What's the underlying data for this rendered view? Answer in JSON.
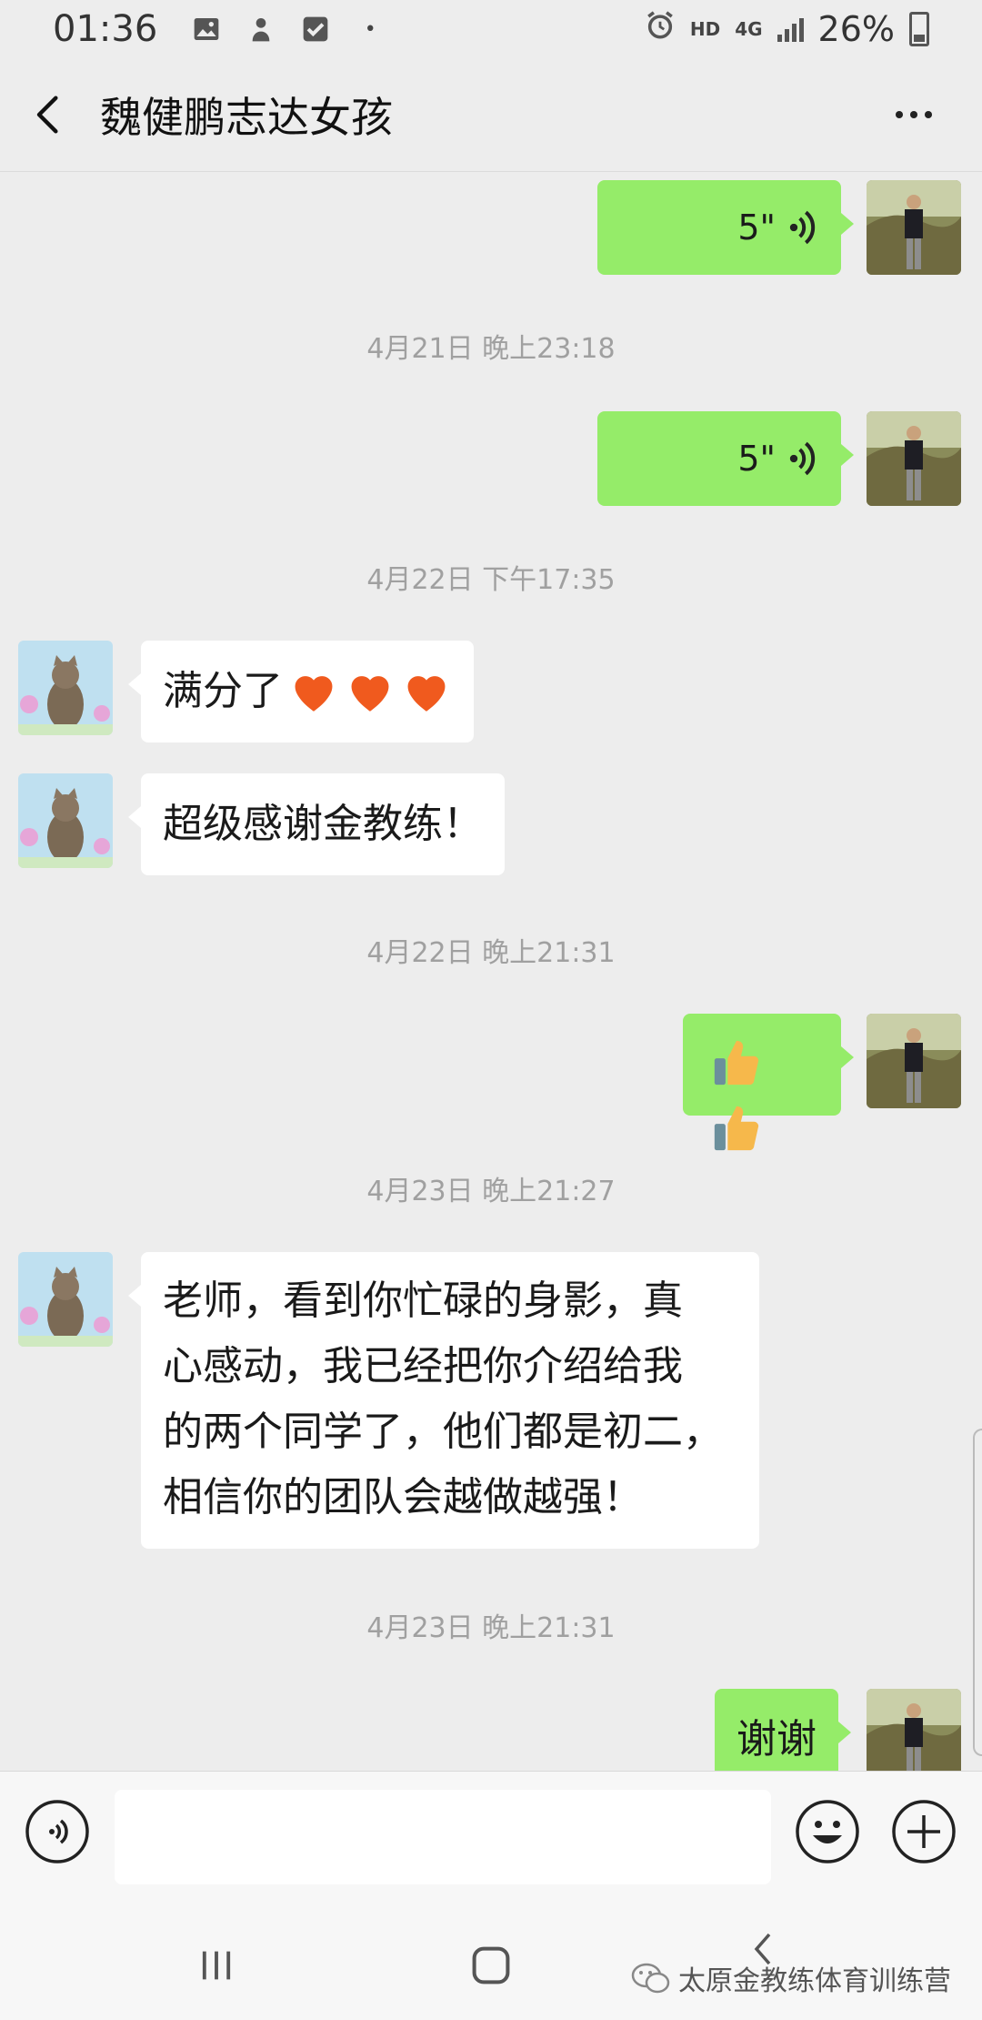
{
  "status_bar": {
    "time": "01:36",
    "network_hd": "HD",
    "network_type": "4G",
    "battery": "26%"
  },
  "header": {
    "title": "魏健鹏志达女孩",
    "back_icon": "chevron-left-icon",
    "more_icon": "more-dots-icon"
  },
  "messages": [
    {
      "kind": "voice",
      "direction": "out",
      "duration": "5\""
    },
    {
      "kind": "time",
      "text": "4月21日 晚上23:18"
    },
    {
      "kind": "voice",
      "direction": "out",
      "duration": "5\""
    },
    {
      "kind": "time",
      "text": "4月22日 下午17:35"
    },
    {
      "kind": "text",
      "direction": "in",
      "text": "满分了"
    },
    {
      "kind": "text",
      "direction": "in",
      "text": "超级感谢金教练！"
    },
    {
      "kind": "time",
      "text": "4月22日 晚上21:31"
    },
    {
      "kind": "emoji",
      "direction": "out",
      "emoji": "thumbs-up x2"
    },
    {
      "kind": "time",
      "text": "4月23日 晚上21:27"
    },
    {
      "kind": "text",
      "direction": "in",
      "lines": [
        "老师，看到你忙碌的身影，真",
        "心感动，我已经把你介绍给我",
        "的两个同学了，他们都是初二，",
        "相信你的团队会越做越强！"
      ]
    },
    {
      "kind": "time",
      "text": "4月23日 晚上21:31"
    },
    {
      "kind": "text",
      "direction": "out",
      "text": "谢谢"
    }
  ],
  "input_bar": {
    "voice_icon": "voice-input-icon",
    "emoji_icon": "emoji-icon",
    "plus_icon": "plus-icon",
    "placeholder": ""
  },
  "watermark": "太原金教练体育训练营",
  "colors": {
    "background": "#ededed",
    "outgoing_bubble": "#95ec69",
    "incoming_bubble": "#ffffff",
    "timestamp": "#a0a0a0"
  }
}
